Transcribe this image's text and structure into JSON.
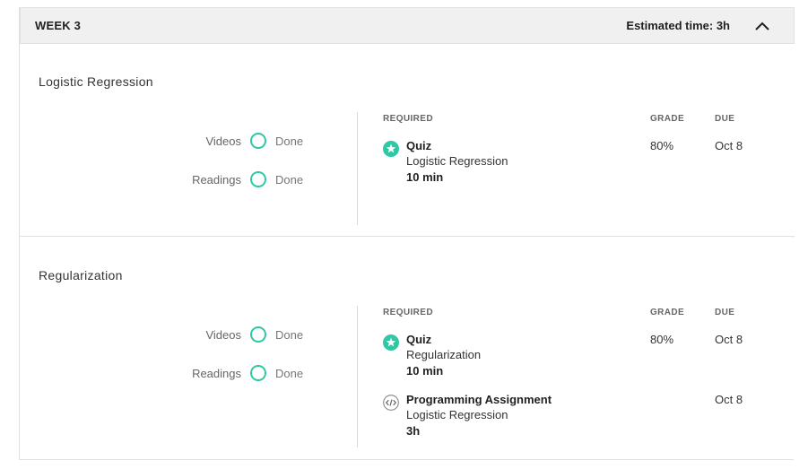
{
  "week": {
    "title": "WEEK 3",
    "estimated_time": "Estimated time: 3h",
    "collapse_icon": "chevron-up-icon"
  },
  "columns": {
    "required": "REQUIRED",
    "grade": "GRADE",
    "due": "DUE"
  },
  "lessons": [
    {
      "title": "Logistic Regression",
      "progress": [
        {
          "label": "Videos",
          "status": "Done"
        },
        {
          "label": "Readings",
          "status": "Done"
        }
      ],
      "items": [
        {
          "icon": "quiz-star-icon",
          "type": "Quiz",
          "name": "Logistic Regression",
          "duration": "10 min",
          "grade": "80%",
          "due": "Oct 8"
        }
      ]
    },
    {
      "title": "Regularization",
      "progress": [
        {
          "label": "Videos",
          "status": "Done"
        },
        {
          "label": "Readings",
          "status": "Done"
        }
      ],
      "items": [
        {
          "icon": "quiz-star-icon",
          "type": "Quiz",
          "name": "Regularization",
          "duration": "10 min",
          "grade": "80%",
          "due": "Oct 8"
        },
        {
          "icon": "code-icon",
          "type": "Programming Assignment",
          "name": "Logistic Regression",
          "duration": "3h",
          "grade": "",
          "due": "Oct 8"
        }
      ]
    }
  ],
  "colors": {
    "accent": "#2ec8a5",
    "header_bg": "#f0f0f0",
    "border": "#e1e1e1"
  }
}
